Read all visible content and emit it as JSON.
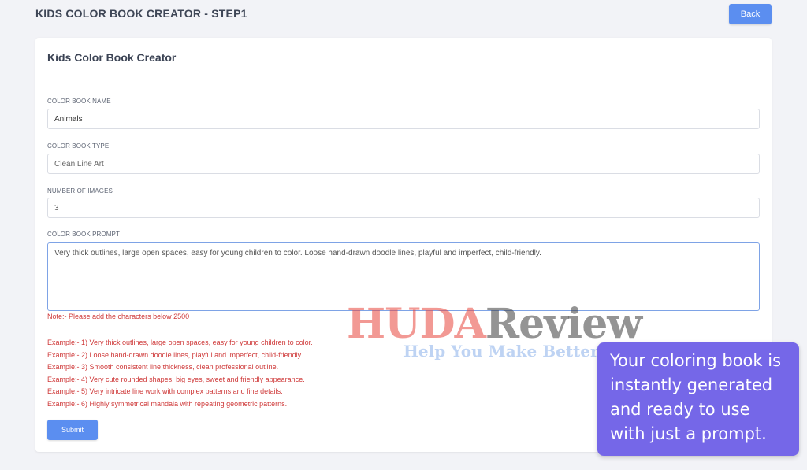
{
  "header": {
    "title": "KIDS COLOR BOOK CREATOR - STEP1",
    "back_label": "Back"
  },
  "card": {
    "title": "Kids Color Book Creator"
  },
  "form": {
    "name_label": "COLOR BOOK NAME",
    "name_value": "Animals",
    "type_label": "COLOR BOOK TYPE",
    "type_value": "Clean Line Art",
    "count_label": "NUMBER OF IMAGES",
    "count_value": "3",
    "prompt_label": "COLOR BOOK PROMPT",
    "prompt_value": "Very thick outlines, large open spaces, easy for young children to color. Loose hand-drawn doodle lines, playful and imperfect, child-friendly.",
    "note": "Note:- Please add the characters below 2500",
    "examples": [
      "Example:- 1) Very thick outlines, large open spaces, easy for young children to color.",
      "Example:- 2) Loose hand-drawn doodle lines, playful and imperfect, child-friendly.",
      "Example:- 3) Smooth consistent line thickness, clean professional outline.",
      "Example:- 4) Very cute rounded shapes, big eyes, sweet and friendly appearance.",
      "Example:- 5) Very intricate line work with complex patterns and fine details.",
      "Example:- 6) Highly symmetrical mandala with repeating geometric patterns."
    ],
    "submit_label": "Submit"
  },
  "watermark": {
    "brand_part1": "HUDA",
    "brand_part2": "Review",
    "tagline": "Help You Make Better Decisions"
  },
  "callout": {
    "text": "Your coloring book is instantly generated and ready to use with just a prompt."
  },
  "colors": {
    "accent": "#5b8ef0",
    "error_text": "#cf3a3a",
    "callout_bg": "#7567e8",
    "page_bg": "#f2f3f7"
  }
}
